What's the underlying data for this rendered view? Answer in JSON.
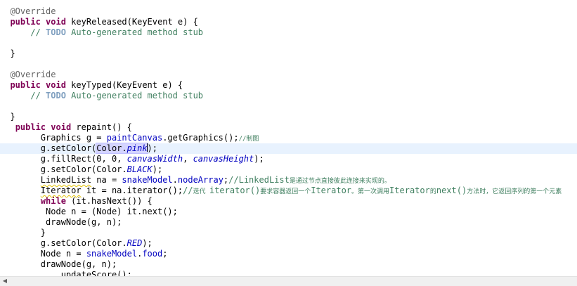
{
  "editor": {
    "lines": [
      {
        "text": "@Override"
      },
      {
        "text": "public void keyReleased(KeyEvent e) {"
      },
      {
        "text": "    // TODO Auto-generated method stub"
      },
      {
        "text": ""
      },
      {
        "text": "}"
      },
      {
        "text": ""
      },
      {
        "text": "@Override"
      },
      {
        "text": "public void keyTyped(KeyEvent e) {"
      },
      {
        "text": "    // TODO Auto-generated method stub"
      },
      {
        "text": ""
      },
      {
        "text": "}"
      },
      {
        "text": " public void repaint() {"
      },
      {
        "text": "    Graphics g = paintCanvas.getGraphics();//制图"
      },
      {
        "text": "    g.setColor(Color.pink);"
      },
      {
        "text": "    g.fillRect(0, 0, canvasWidth, canvasHeight);"
      },
      {
        "text": "    g.setColor(Color.BLACK);"
      },
      {
        "text": "    LinkedList na = snakeModel.nodeArray;//LinkedList是通过节点直接彼此连接来实现的。"
      },
      {
        "text": "    Iterator it = na.iterator();//迭代 iterator()要求容器返回一个Iterator。第一次调用Iterator的next()方法时，它返回序列的第一个元素"
      },
      {
        "text": "    while (it.hasNext()) {"
      },
      {
        "text": "     Node n = (Node) it.next();"
      },
      {
        "text": "     drawNode(g, n);"
      },
      {
        "text": "    }"
      },
      {
        "text": "    g.setColor(Color.RED);"
      },
      {
        "text": "    Node n = snakeModel.food;"
      },
      {
        "text": "    drawNode(g, n);"
      },
      {
        "text": "    updateScore();"
      }
    ]
  },
  "icons": {
    "scroll_left": "scroll-left-arrow-icon"
  }
}
